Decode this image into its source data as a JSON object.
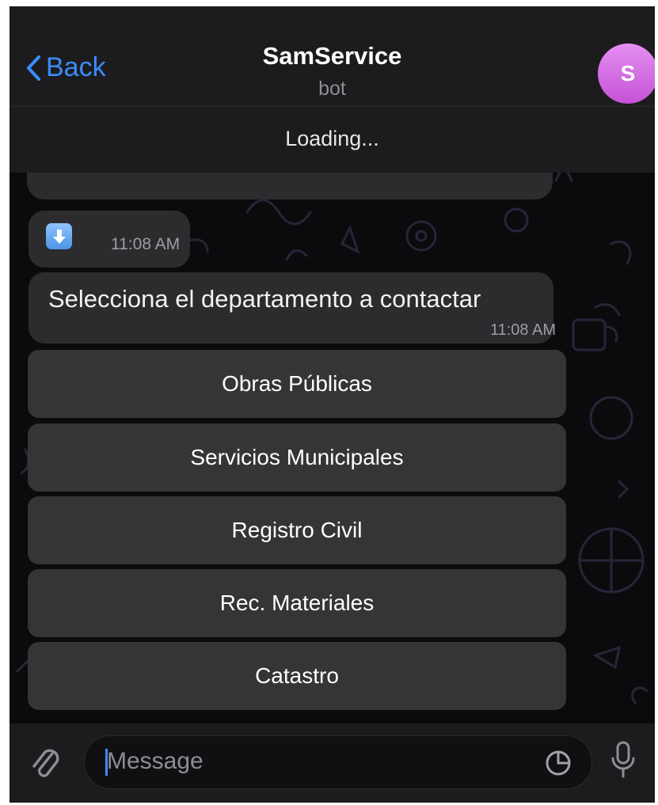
{
  "header": {
    "back_label": "Back",
    "title": "SamService",
    "subtitle": "bot",
    "avatar_letter": "S",
    "accent_color": "#3b8cff"
  },
  "loading_text": "Loading...",
  "messages": {
    "image_time": "11:08 AM",
    "text": "Selecciona el departamento a contactar",
    "text_time": "11:08 AM"
  },
  "keyboard": {
    "buttons": [
      {
        "label": "Obras Públicas"
      },
      {
        "label": "Servicios Municipales"
      },
      {
        "label": "Registro Civil"
      },
      {
        "label": "Rec. Materiales"
      },
      {
        "label": "Catastro"
      }
    ]
  },
  "input": {
    "placeholder": "Message",
    "icons": [
      "paperclip-icon",
      "sticker-icon",
      "microphone-icon"
    ]
  }
}
